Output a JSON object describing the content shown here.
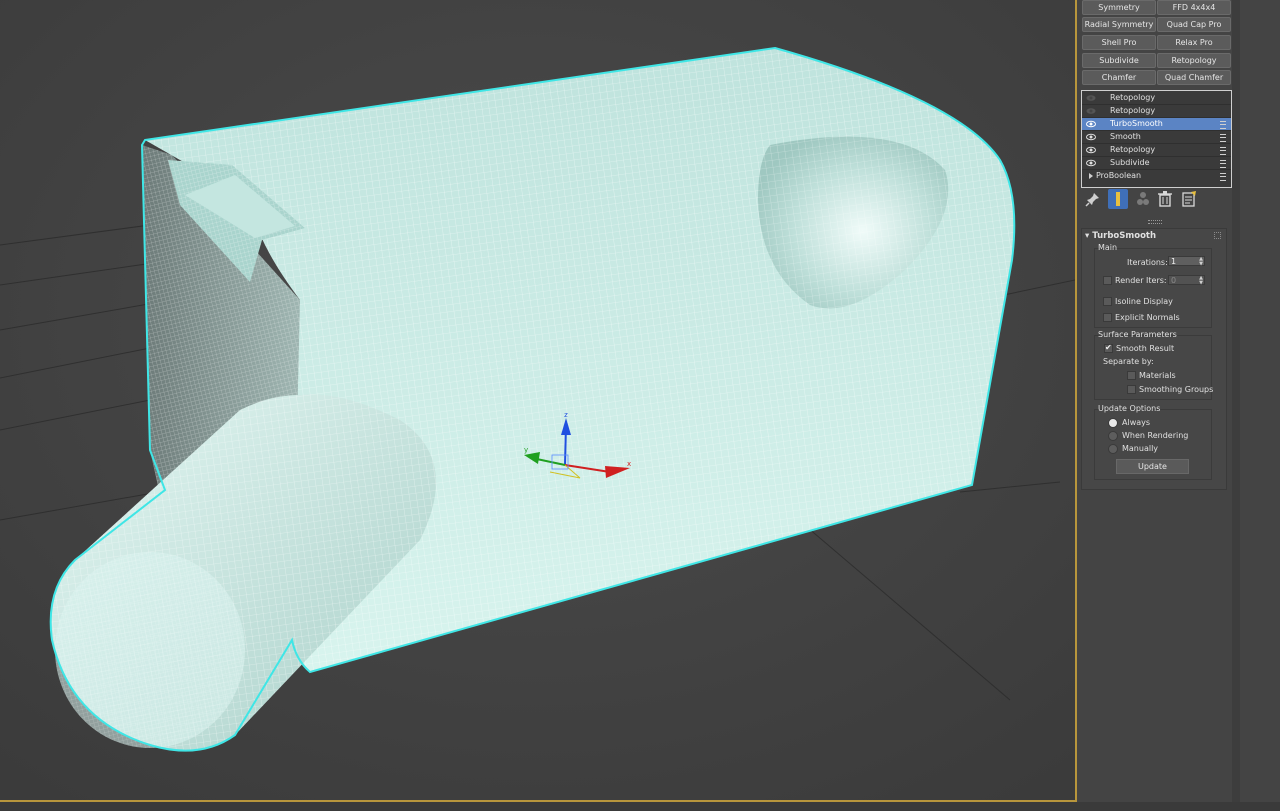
{
  "modifier_buttons": [
    {
      "label": "Symmetry"
    },
    {
      "label": "FFD 4x4x4"
    },
    {
      "label": "Radial Symmetry"
    },
    {
      "label": "Quad Cap Pro"
    },
    {
      "label": "Shell Pro"
    },
    {
      "label": "Relax Pro"
    },
    {
      "label": "Subdivide"
    },
    {
      "label": "Retopology"
    },
    {
      "label": "Chamfer"
    },
    {
      "label": "Quad Chamfer"
    }
  ],
  "stack": {
    "items": [
      {
        "label": "Retopology",
        "visible": false
      },
      {
        "label": "Retopology",
        "visible": false
      },
      {
        "label": "TurboSmooth",
        "visible": true,
        "selected": true
      },
      {
        "label": "Smooth",
        "visible": true
      },
      {
        "label": "Retopology",
        "visible": true
      },
      {
        "label": "Subdivide",
        "visible": true
      },
      {
        "label": "ProBoolean",
        "visible": false,
        "base": true
      }
    ]
  },
  "stack_tools": [
    {
      "icon": "pin-icon"
    },
    {
      "icon": "show-end-result-icon"
    },
    {
      "icon": "make-unique-icon"
    },
    {
      "icon": "trash-icon"
    },
    {
      "icon": "configure-sets-icon"
    }
  ],
  "turbosmooth": {
    "title": "TurboSmooth",
    "main": {
      "title": "Main",
      "iterations_label": "Iterations:",
      "iterations_value": "1",
      "render_iters_label": "Render Iters:",
      "render_iters_value": "0",
      "render_iters_checked": false,
      "isoline_label": "Isoline Display",
      "isoline_checked": false,
      "explicit_label": "Explicit Normals",
      "explicit_checked": false
    },
    "surface": {
      "title": "Surface Parameters",
      "smooth_result_label": "Smooth Result",
      "smooth_result_checked": true,
      "separate_by_label": "Separate by:",
      "materials_label": "Materials",
      "materials_checked": false,
      "smoothing_groups_label": "Smoothing Groups",
      "smoothing_groups_checked": false
    },
    "update": {
      "title": "Update Options",
      "always_label": "Always",
      "when_rendering_label": "When Rendering",
      "manually_label": "Manually",
      "selected": "always",
      "update_button": "Update"
    }
  },
  "gizmo": {
    "z_label": "z",
    "y_label": "y",
    "x_label": "x"
  },
  "colors": {
    "viewport_bg": "#444444",
    "mesh_fill": "#cdeee8",
    "mesh_wire": "#ffffff",
    "selection_outline": "#3fe6e6",
    "active_border": "#b8963c",
    "stack_selected": "#5b84c4",
    "axis_x": "#d02020",
    "axis_y": "#20a020",
    "axis_z": "#2050e0"
  }
}
